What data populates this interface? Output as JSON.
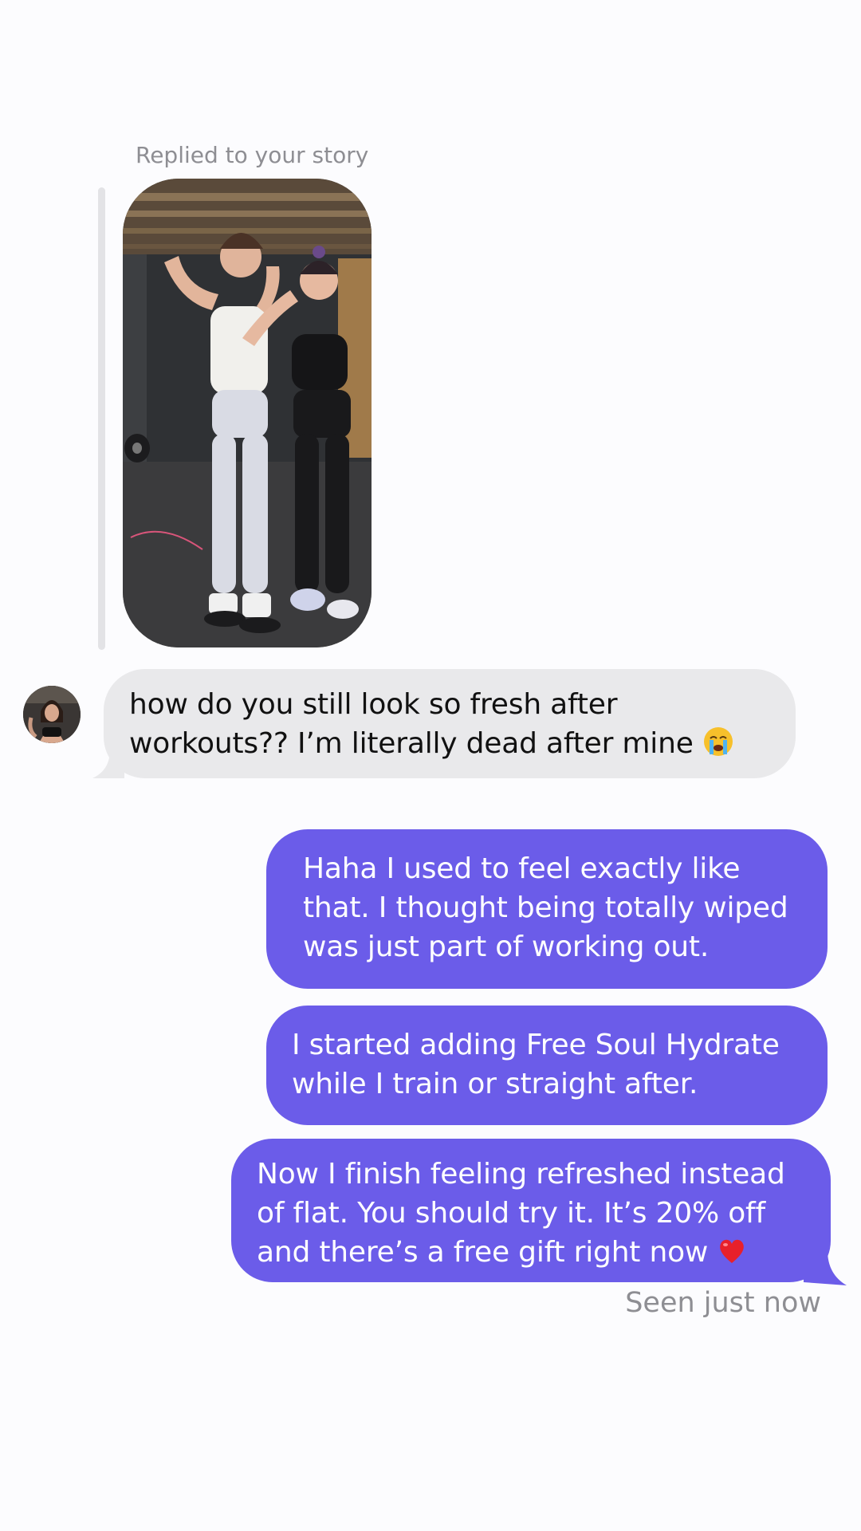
{
  "story_reply": {
    "caption": "Replied to your story"
  },
  "messages": {
    "incoming": [
      {
        "line1": "how do you still look so fresh after",
        "line2": "workouts?? I’m literally dead after mine",
        "emoji": "loudly-crying-face"
      }
    ],
    "outgoing": [
      {
        "lines": [
          "Haha I used to feel exactly like",
          "that. I thought being totally wiped",
          "was just part of working out."
        ]
      },
      {
        "lines": [
          "I started adding Free Soul Hydrate",
          "while I train or straight after."
        ]
      },
      {
        "lines": [
          "Now I finish feeling refreshed instead",
          "of flat. You should try it. It’s 20% off",
          "and there’s a free gift right now"
        ],
        "emoji": "red-heart"
      }
    ]
  },
  "status": {
    "seen": "Seen just now"
  },
  "colors": {
    "background": "#fcfcfe",
    "incoming_bubble": "#e9e9eb",
    "outgoing_bubble": "#6b5ce9",
    "meta_text": "#8e8e93"
  }
}
